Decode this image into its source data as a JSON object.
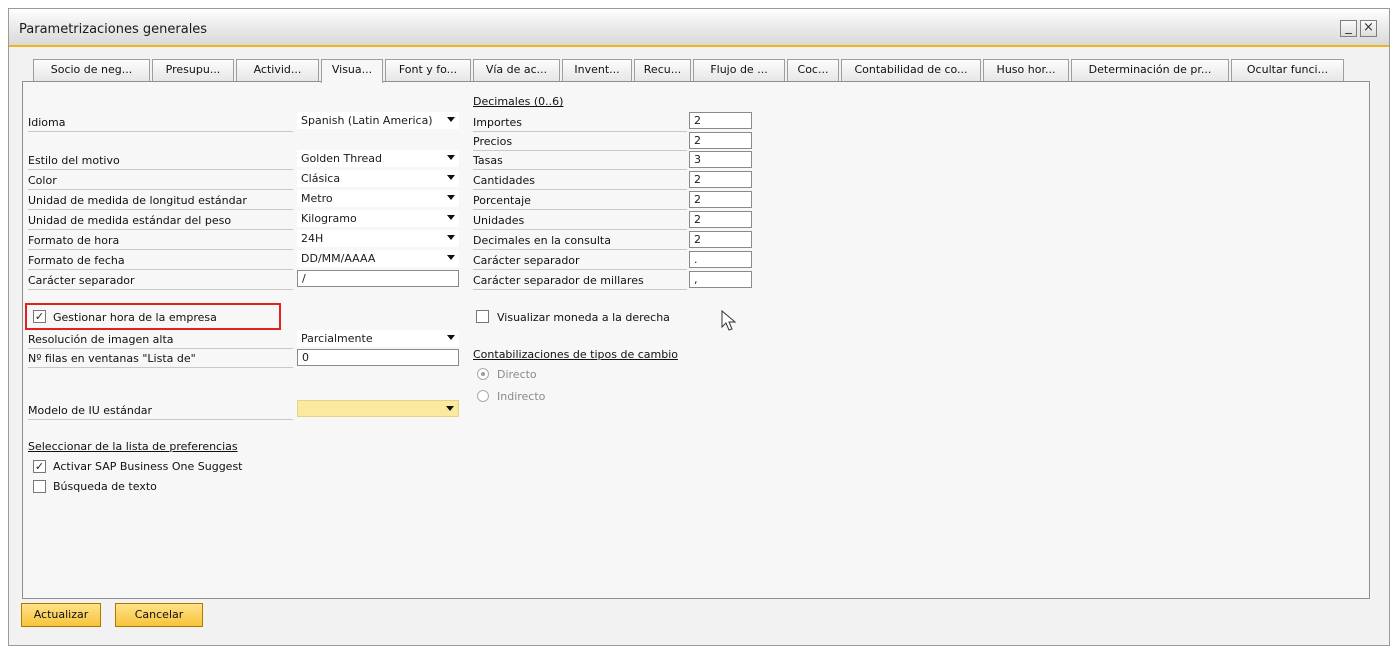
{
  "window": {
    "title": "Parametrizaciones generales",
    "minimize": "_",
    "close": "×"
  },
  "tabs": [
    "Socio de neg...",
    "Presupu...",
    "Activid...",
    "Visua...",
    "Font y fo...",
    "Vía de ac...",
    "Invent...",
    "Recu...",
    "Flujo de ...",
    "Coc...",
    "Contabilidad de co...",
    "Huso hor...",
    "Determinación de pr...",
    "Ocultar funci..."
  ],
  "left": {
    "idioma": {
      "label": "Idioma",
      "value": "Spanish (Latin America)"
    },
    "estilo": {
      "label": "Estilo del motivo",
      "value": "Golden Thread"
    },
    "color": {
      "label": "Color",
      "value": "Clásica"
    },
    "longitud": {
      "label": "Unidad de medida de longitud estándar",
      "value": "Metro"
    },
    "peso": {
      "label": "Unidad de medida estándar del peso",
      "value": "Kilogramo"
    },
    "hora": {
      "label": "Formato de hora",
      "value": "24H"
    },
    "fecha": {
      "label": "Formato de fecha",
      "value": "DD/MM/AAAA"
    },
    "separador": {
      "label": "Carácter separador",
      "value": "/"
    },
    "gestionar": {
      "label": "Gestionar hora de la empresa",
      "checked": "✓"
    },
    "resolucion": {
      "label": "Resolución de imagen alta",
      "value": "Parcialmente"
    },
    "filas": {
      "label": "Nº filas en ventanas \"Lista de\"",
      "value": "0"
    },
    "modelo": {
      "label": "Modelo de IU estándar",
      "value": ""
    },
    "preferencias": {
      "title": "Seleccionar de la lista de preferencias",
      "suggest": {
        "label": "Activar SAP Business One Suggest",
        "checked": "✓"
      },
      "busqueda": {
        "label": "Búsqueda de texto",
        "checked": ""
      }
    }
  },
  "right": {
    "decimales_title": "Decimales  (0..6)",
    "rows": [
      {
        "label": "Importes",
        "value": "2"
      },
      {
        "label": "Precios",
        "value": "2"
      },
      {
        "label": "Tasas",
        "value": "3"
      },
      {
        "label": "Cantidades",
        "value": "2"
      },
      {
        "label": "Porcentaje",
        "value": "2"
      },
      {
        "label": "Unidades",
        "value": "2"
      },
      {
        "label": "Decimales en la consulta",
        "value": "2"
      },
      {
        "label": "Carácter separador",
        "value": "."
      },
      {
        "label": "Carácter separador de millares",
        "value": ","
      }
    ],
    "moneda": {
      "label": "Visualizar moneda a la derecha",
      "checked": ""
    },
    "contab_title": "Contabilizaciones de tipos de cambio",
    "directo": "Directo",
    "indirecto": "Indirecto"
  },
  "buttons": {
    "update": "Actualizar",
    "cancel": "Cancelar"
  },
  "colors": {
    "accent": "#f0b41c",
    "highlight": "#e0231a",
    "button": "#f7c43a",
    "modelo_field": "#fbe9a0"
  }
}
